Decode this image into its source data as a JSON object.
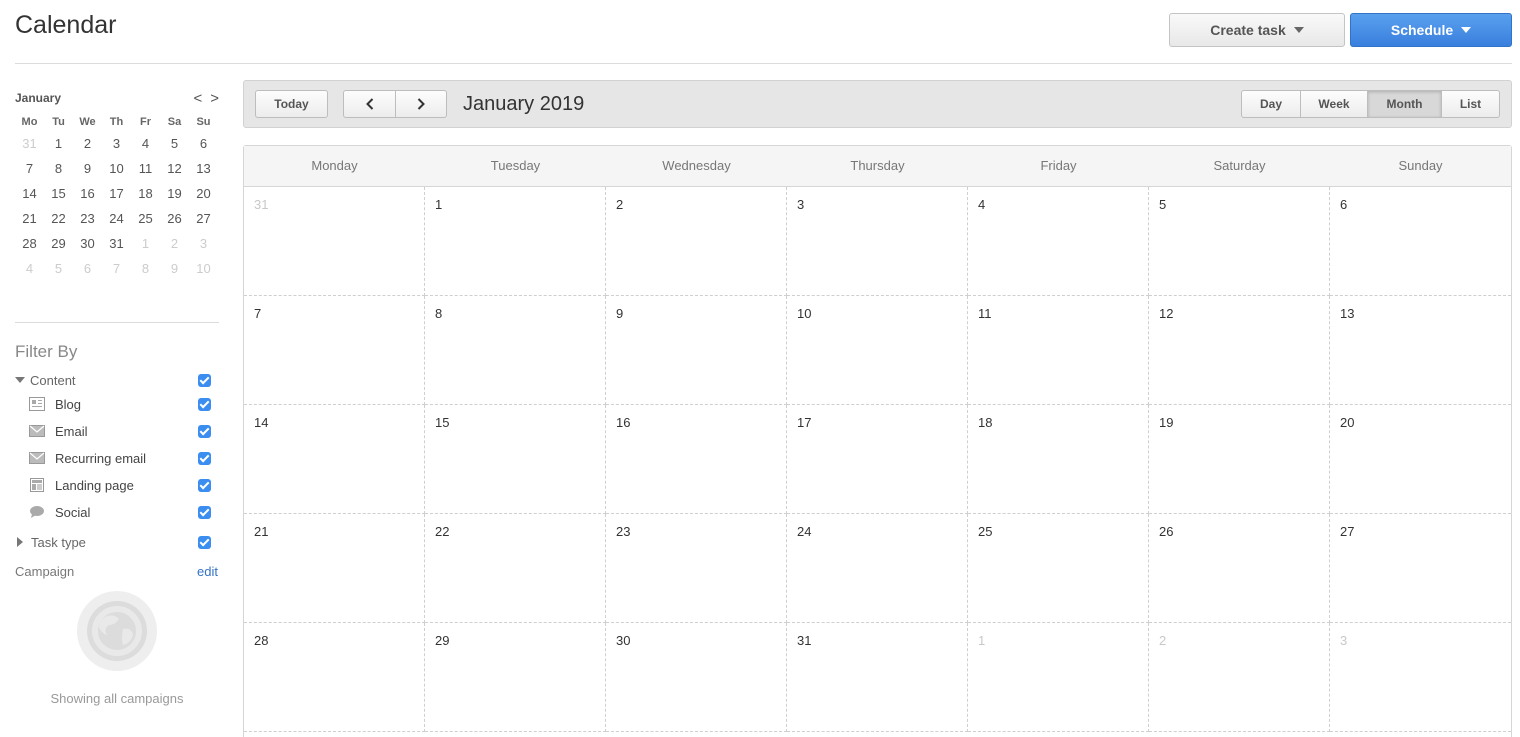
{
  "header": {
    "title": "Calendar",
    "create_task_label": "Create task",
    "schedule_label": "Schedule"
  },
  "mini_calendar": {
    "month": "January",
    "prev_glyph": "<",
    "next_glyph": ">",
    "weekdays": [
      "Mo",
      "Tu",
      "We",
      "Th",
      "Fr",
      "Sa",
      "Su"
    ],
    "days": [
      {
        "d": "31",
        "muted": true
      },
      {
        "d": "1"
      },
      {
        "d": "2"
      },
      {
        "d": "3"
      },
      {
        "d": "4"
      },
      {
        "d": "5"
      },
      {
        "d": "6"
      },
      {
        "d": "7"
      },
      {
        "d": "8"
      },
      {
        "d": "9"
      },
      {
        "d": "10"
      },
      {
        "d": "11"
      },
      {
        "d": "12"
      },
      {
        "d": "13"
      },
      {
        "d": "14"
      },
      {
        "d": "15"
      },
      {
        "d": "16"
      },
      {
        "d": "17"
      },
      {
        "d": "18"
      },
      {
        "d": "19"
      },
      {
        "d": "20"
      },
      {
        "d": "21"
      },
      {
        "d": "22"
      },
      {
        "d": "23"
      },
      {
        "d": "24"
      },
      {
        "d": "25"
      },
      {
        "d": "26"
      },
      {
        "d": "27"
      },
      {
        "d": "28"
      },
      {
        "d": "29"
      },
      {
        "d": "30"
      },
      {
        "d": "31"
      },
      {
        "d": "1",
        "muted": true
      },
      {
        "d": "2",
        "muted": true
      },
      {
        "d": "3",
        "muted": true
      },
      {
        "d": "4",
        "muted": true
      },
      {
        "d": "5",
        "muted": true
      },
      {
        "d": "6",
        "muted": true
      },
      {
        "d": "7",
        "muted": true
      },
      {
        "d": "8",
        "muted": true
      },
      {
        "d": "9",
        "muted": true
      },
      {
        "d": "10",
        "muted": true
      }
    ]
  },
  "filter": {
    "title": "Filter By",
    "content_group": {
      "label": "Content",
      "checked": true
    },
    "content_items": [
      {
        "label": "Blog",
        "icon": "blog-icon",
        "checked": true
      },
      {
        "label": "Email",
        "icon": "email-icon",
        "checked": true
      },
      {
        "label": "Recurring email",
        "icon": "recurring-email-icon",
        "checked": true
      },
      {
        "label": "Landing page",
        "icon": "landing-page-icon",
        "checked": true
      },
      {
        "label": "Social",
        "icon": "social-icon",
        "checked": true
      }
    ],
    "task_type": {
      "label": "Task type",
      "checked": true
    },
    "campaign_label": "Campaign",
    "campaign_edit": "edit",
    "campaign_empty": "Showing all campaigns"
  },
  "toolbar": {
    "today": "Today",
    "prev_glyph": "<",
    "next_glyph": ">",
    "title": "January 2019",
    "views": [
      {
        "label": "Day",
        "active": false
      },
      {
        "label": "Week",
        "active": false
      },
      {
        "label": "Month",
        "active": true
      },
      {
        "label": "List",
        "active": false
      }
    ]
  },
  "calendar": {
    "weekdays": [
      "Monday",
      "Tuesday",
      "Wednesday",
      "Thursday",
      "Friday",
      "Saturday",
      "Sunday"
    ],
    "days": [
      {
        "d": "31",
        "muted": true
      },
      {
        "d": "1"
      },
      {
        "d": "2"
      },
      {
        "d": "3"
      },
      {
        "d": "4"
      },
      {
        "d": "5"
      },
      {
        "d": "6"
      },
      {
        "d": "7"
      },
      {
        "d": "8"
      },
      {
        "d": "9"
      },
      {
        "d": "10"
      },
      {
        "d": "11"
      },
      {
        "d": "12"
      },
      {
        "d": "13"
      },
      {
        "d": "14"
      },
      {
        "d": "15"
      },
      {
        "d": "16"
      },
      {
        "d": "17"
      },
      {
        "d": "18"
      },
      {
        "d": "19"
      },
      {
        "d": "20"
      },
      {
        "d": "21"
      },
      {
        "d": "22"
      },
      {
        "d": "23"
      },
      {
        "d": "24"
      },
      {
        "d": "25"
      },
      {
        "d": "26"
      },
      {
        "d": "27"
      },
      {
        "d": "28"
      },
      {
        "d": "29"
      },
      {
        "d": "30"
      },
      {
        "d": "31"
      },
      {
        "d": "1",
        "muted": true
      },
      {
        "d": "2",
        "muted": true
      },
      {
        "d": "3",
        "muted": true
      }
    ]
  },
  "colors": {
    "accent": "#3b8df0",
    "link": "#3573c4",
    "schedule_button": "#4a90e2"
  }
}
